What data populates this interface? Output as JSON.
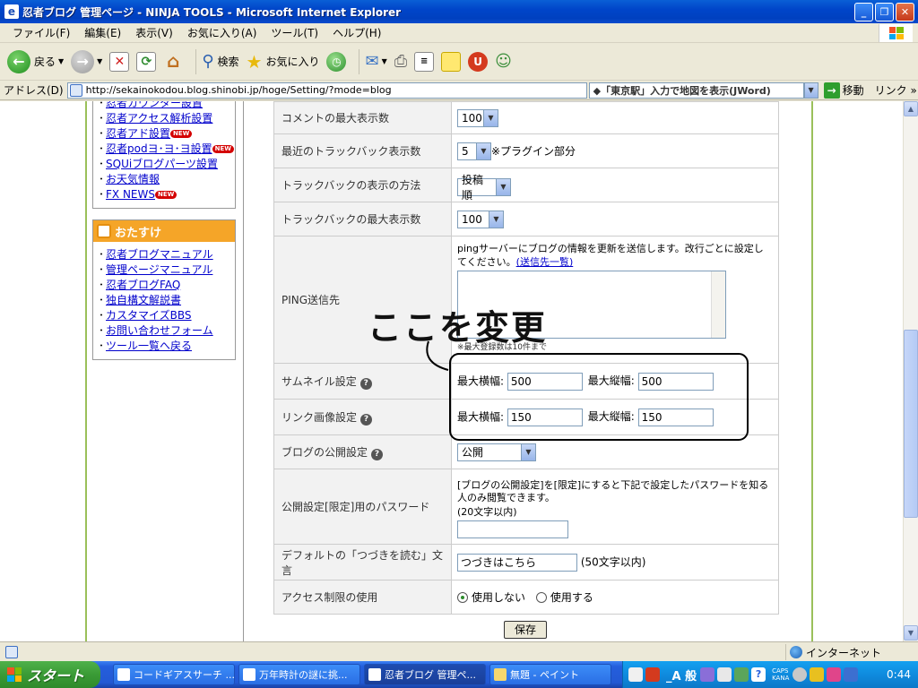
{
  "window": {
    "title": "忍者ブログ 管理ページ - NINJA TOOLS - Microsoft Internet Explorer"
  },
  "menu": [
    "ファイル(F)",
    "編集(E)",
    "表示(V)",
    "お気に入り(A)",
    "ツール(T)",
    "ヘルプ(H)"
  ],
  "toolbar": {
    "back_label": "戻る",
    "search_label": "検索",
    "favorites_label": "お気に入り"
  },
  "address": {
    "label": "アドレス(D)",
    "url": "http://sekainokodou.blog.shinobi.jp/hoge/Setting/?mode=blog",
    "hint": "◆「東京駅」入力で地図を表示(JWord)",
    "go_label": "移動",
    "links_label": "リンク »"
  },
  "sidebar": {
    "tools": [
      {
        "label": "忍者カウンター設置",
        "new": false
      },
      {
        "label": "忍者アクセス解析設置",
        "new": false
      },
      {
        "label": "忍者アド設置",
        "new": true
      },
      {
        "label": "忍者podヨ･ヨ･ヨ設置",
        "new": true
      },
      {
        "label": "SQUiブログパーツ設置",
        "new": false
      },
      {
        "label": "お天気情報",
        "new": false
      },
      {
        "label": "FX NEWS",
        "new": true
      }
    ],
    "new_badge": "NEW",
    "osusume_title": "おたすけ",
    "osusume": [
      "忍者ブログマニュアル",
      "管理ページマニュアル",
      "忍者ブログFAQ",
      "独自構文解説書",
      "カスタマイズBBS",
      "お問い合わせフォーム",
      "ツール一覧へ戻る"
    ]
  },
  "settings": {
    "comment_max_label": "コメントの最大表示数",
    "comment_max_value": "100",
    "recent_tb_label": "最近のトラックバック表示数",
    "recent_tb_value": "5",
    "recent_tb_note": "※プラグイン部分",
    "tb_method_label": "トラックバックの表示の方法",
    "tb_method_value": "投稿順",
    "tb_max_label": "トラックバックの最大表示数",
    "tb_max_value": "100",
    "ping_label": "PING送信先",
    "ping_desc": "pingサーバーにブログの情報を更新を送信します。改行ごとに設定してください。",
    "ping_link": "(送信先一覧)",
    "ping_note": "※最大登録数は10件まで",
    "thumb_label": "サムネイル設定",
    "link_img_label": "リンク画像設定",
    "max_width_label": "最大横幅:",
    "max_height_label": "最大縦幅:",
    "thumb_width": "500",
    "thumb_height": "500",
    "link_width": "150",
    "link_height": "150",
    "public_label": "ブログの公開設定",
    "public_value": "公開",
    "password_label": "公開設定[限定]用のパスワード",
    "password_desc": "[ブログの公開設定]を[限定]にすると下記で設定したパスワードを知る人のみ閲覧できます。",
    "password_limit": "(20文字以内)",
    "password_value": "",
    "continue_label": "デフォルトの「つづきを読む」文言",
    "continue_value": "つづきはこちら",
    "continue_limit": "(50文字以内)",
    "access_label": "アクセス制限の使用",
    "access_off": "使用しない",
    "access_on": "使用する",
    "save_label": "保存"
  },
  "annotation": {
    "text": "ここを変更"
  },
  "status": {
    "zone": "インターネット"
  },
  "taskbar": {
    "start_label": "スタート",
    "tasks": [
      "コードギアスサーチ ...",
      "万年時計の謎に挑...",
      "忍者ブログ 管理ペ...",
      "無題 - ペイント"
    ],
    "ime": "_A 般",
    "caps": "CAPS",
    "kana": "KANA",
    "clock": "0:44"
  },
  "colors": {
    "osusume_orange": "#F5A528",
    "link_blue": "#0000CC",
    "new_red": "#D40000"
  }
}
